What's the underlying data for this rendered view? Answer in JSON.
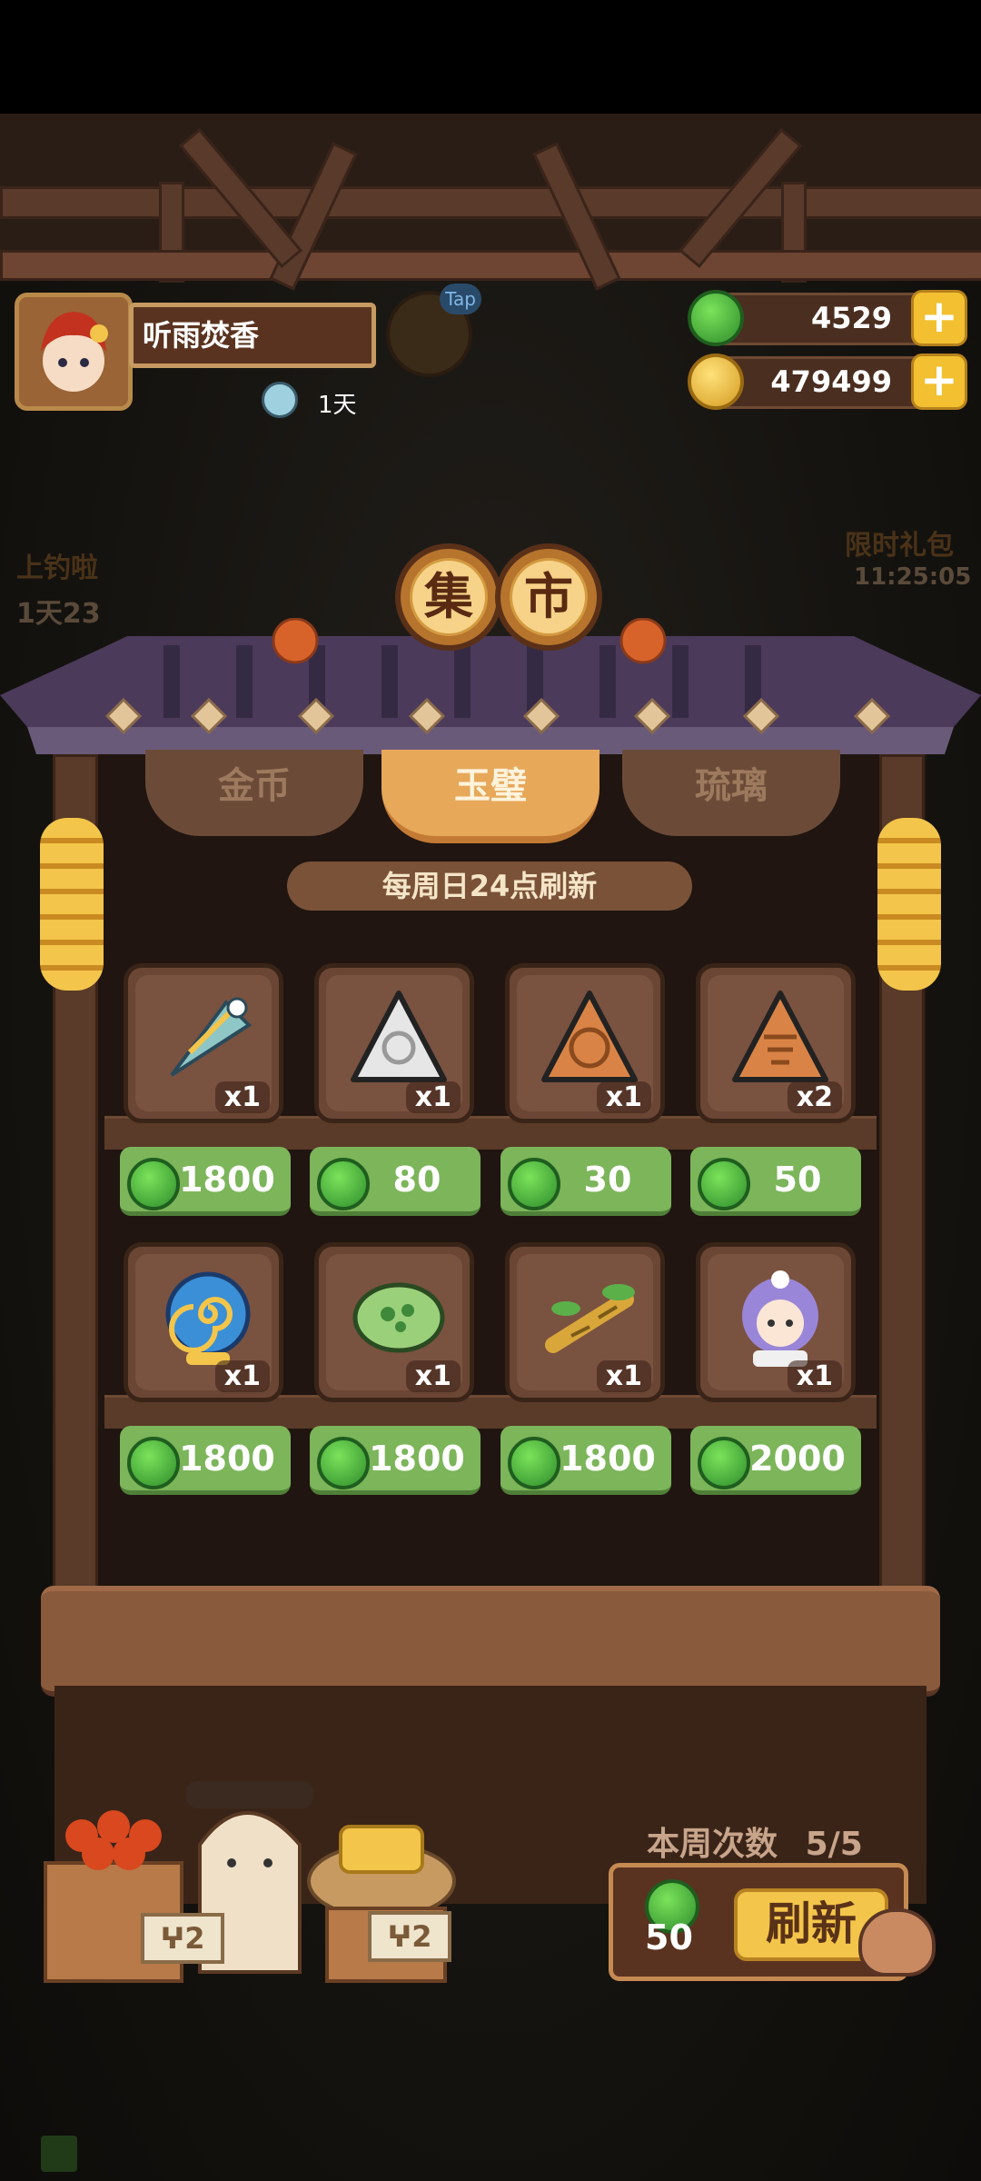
{
  "player": {
    "name": "听雨焚香",
    "days": "1天"
  },
  "tap_badge": "Tap",
  "currency": {
    "jade": "4529",
    "coins": "479499"
  },
  "left_event": {
    "label": "上钓啦",
    "timer": "1天23"
  },
  "right_event": {
    "label": "限时礼包",
    "timer": "11:25:05"
  },
  "title": [
    "集",
    "市"
  ],
  "tabs": [
    {
      "label": "金币"
    },
    {
      "label": "玉璧"
    },
    {
      "label": "琉璃"
    }
  ],
  "refresh_note": "每周日24点刷新",
  "items": [
    {
      "icon": "umbrella-icon",
      "qty": "x1",
      "price": "1800"
    },
    {
      "icon": "white-stone-icon",
      "qty": "x1",
      "price": "80"
    },
    {
      "icon": "orange-stone-icon",
      "qty": "x1",
      "price": "30"
    },
    {
      "icon": "rune-stone-icon",
      "qty": "x2",
      "price": "50"
    },
    {
      "icon": "spiral-shell-icon",
      "qty": "x1",
      "price": "1800"
    },
    {
      "icon": "green-jade-icon",
      "qty": "x1",
      "price": "1800"
    },
    {
      "icon": "bamboo-icon",
      "qty": "x1",
      "price": "1800"
    },
    {
      "icon": "character-icon",
      "qty": "x1",
      "price": "2000"
    }
  ],
  "weekly": {
    "label": "本周次数",
    "count": "5/5"
  },
  "refresh": {
    "cost": "50",
    "label": "刷新"
  },
  "vendor_tags": [
    "ⵖ2",
    "ⵖ2"
  ]
}
